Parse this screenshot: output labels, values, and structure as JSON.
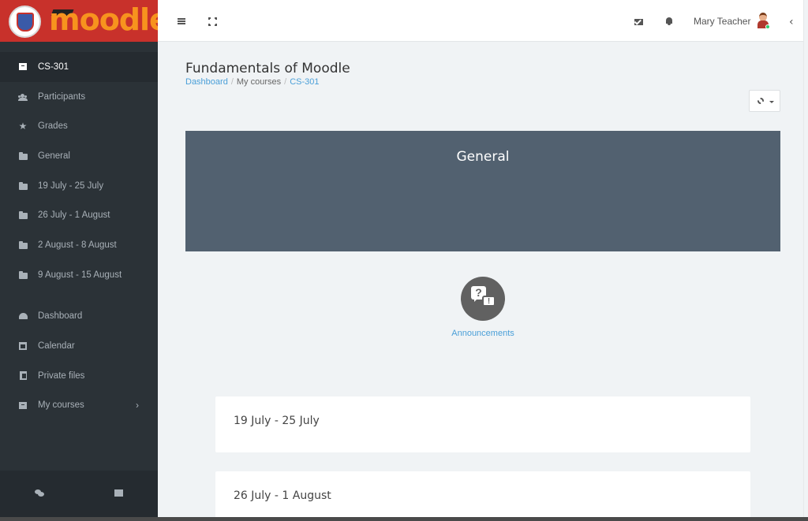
{
  "brand": {
    "logo_text": "moodle",
    "seal_text": "University seal"
  },
  "sidebar": {
    "items": [
      {
        "label": "CS-301",
        "icon": "course-box-icon",
        "active": true
      },
      {
        "label": "Participants",
        "icon": "users-icon"
      },
      {
        "label": "Grades",
        "icon": "star-icon"
      },
      {
        "label": "General",
        "icon": "folder-icon"
      },
      {
        "label": "19 July - 25 July",
        "icon": "folder-icon"
      },
      {
        "label": "26 July - 1 August",
        "icon": "folder-icon"
      },
      {
        "label": "2 August - 8 August",
        "icon": "folder-icon"
      },
      {
        "label": "9 August - 15 August",
        "icon": "folder-icon"
      }
    ],
    "global_items": [
      {
        "label": "Dashboard",
        "icon": "dashboard-icon"
      },
      {
        "label": "Calendar",
        "icon": "calendar-icon"
      },
      {
        "label": "Private files",
        "icon": "files-icon"
      },
      {
        "label": "My courses",
        "icon": "course-box-icon",
        "chevron": "›"
      }
    ],
    "footer_icons": [
      "chat-icon",
      "archive-icon"
    ]
  },
  "topbar": {
    "user_name": "Mary Teacher",
    "collapse_glyph": "‹"
  },
  "page": {
    "title": "Fundamentals of Moodle",
    "breadcrumb": {
      "dashboard": "Dashboard",
      "sep": "/",
      "my_courses": "My courses",
      "course": "CS-301"
    }
  },
  "general": {
    "title": "General",
    "activity": {
      "label": "Announcements",
      "glyph_q": "?",
      "glyph_ex": "!"
    }
  },
  "sections": [
    {
      "title": "19 July - 25 July"
    },
    {
      "title": "26 July - 1 August"
    }
  ],
  "colors": {
    "brand_red": "#c8312b",
    "brand_orange": "#f7931e",
    "sidebar_bg": "#2b3237",
    "banner_bg": "#526170",
    "link": "#4a9fd8"
  }
}
